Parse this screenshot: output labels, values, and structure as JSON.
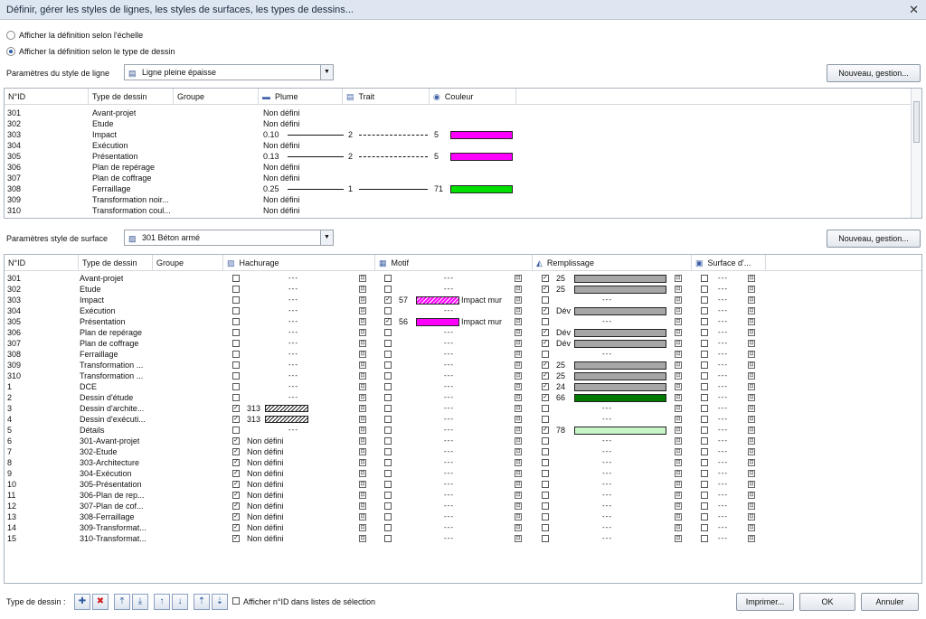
{
  "window": {
    "title": "Définir, gérer les styles de lignes, les styles de surfaces, les types de dessins...",
    "close_icon": "close-icon"
  },
  "options": {
    "radio_scale": "Afficher la définition selon l'échelle",
    "radio_type": "Afficher la définition selon le type de dessin",
    "selected": "radio_type"
  },
  "line_style": {
    "label": "Paramètres du style de ligne",
    "value": "Ligne pleine épaisse",
    "button": "Nouveau, gestion...",
    "columns": [
      "N°ID",
      "Type de dessin",
      "Groupe",
      "Plume",
      "Trait",
      "Couleur"
    ],
    "rows": [
      {
        "id": "301",
        "type": "Avant-projet",
        "plume": "Non défini",
        "trait": "",
        "couleur": "",
        "color": ""
      },
      {
        "id": "302",
        "type": "Etude",
        "plume": "Non défini",
        "trait": "",
        "couleur": "",
        "color": ""
      },
      {
        "id": "303",
        "type": "Impact",
        "plume": "0.10",
        "trait": "2",
        "couleur": "5",
        "color": "#ff00ff",
        "style": "dash"
      },
      {
        "id": "304",
        "type": "Exécution",
        "plume": "Non défini",
        "trait": "",
        "couleur": "",
        "color": ""
      },
      {
        "id": "305",
        "type": "Présentation",
        "plume": "0.13",
        "trait": "2",
        "couleur": "5",
        "color": "#ff00ff",
        "style": "dash"
      },
      {
        "id": "306",
        "type": "Plan de repérage",
        "plume": "Non défini",
        "trait": "",
        "couleur": "",
        "color": ""
      },
      {
        "id": "307",
        "type": "Plan de coffrage",
        "plume": "Non défini",
        "trait": "",
        "couleur": "",
        "color": ""
      },
      {
        "id": "308",
        "type": "Ferraillage",
        "plume": "0.25",
        "trait": "1",
        "couleur": "71",
        "color": "#00e000",
        "style": "solid"
      },
      {
        "id": "309",
        "type": "Transformation noir...",
        "plume": "Non défini",
        "trait": "",
        "couleur": "",
        "color": ""
      },
      {
        "id": "310",
        "type": "Transformation coul...",
        "plume": "Non défini",
        "trait": "",
        "couleur": "",
        "color": ""
      }
    ]
  },
  "surface_style": {
    "label": "Paramètres style de surface",
    "value": "301 Béton armé",
    "button": "Nouveau, gestion...",
    "columns": [
      "N°ID",
      "Type de dessin",
      "Groupe",
      "Hachurage",
      "Motif",
      "Remplissage",
      "Surface d'..."
    ],
    "dashes": "---",
    "rows": [
      {
        "id": "301",
        "type": "Avant-projet",
        "h_chk": false,
        "h_val": "",
        "m_chk": false,
        "m_val": "",
        "m_txt": "",
        "r_chk": true,
        "r_val": "25",
        "r_color": "#a6a6a6"
      },
      {
        "id": "302",
        "type": "Etude",
        "h_chk": false,
        "h_val": "",
        "m_chk": false,
        "m_val": "",
        "m_txt": "",
        "r_chk": true,
        "r_val": "25",
        "r_color": "#a6a6a6"
      },
      {
        "id": "303",
        "type": "Impact",
        "h_chk": false,
        "h_val": "",
        "m_chk": true,
        "m_val": "57",
        "m_txt": "Impact mur",
        "m_color": "pattern",
        "r_chk": false,
        "r_val": "",
        "r_color": ""
      },
      {
        "id": "304",
        "type": "Exécution",
        "h_chk": false,
        "h_val": "",
        "m_chk": false,
        "m_val": "",
        "m_txt": "",
        "r_chk": true,
        "r_val": "Dév",
        "r_color": "#a6a6a6"
      },
      {
        "id": "305",
        "type": "Présentation",
        "h_chk": false,
        "h_val": "",
        "m_chk": true,
        "m_val": "56",
        "m_txt": "Impact mur",
        "m_color": "#ff00ff",
        "r_chk": false,
        "r_val": "",
        "r_color": ""
      },
      {
        "id": "306",
        "type": "Plan de repérage",
        "h_chk": false,
        "h_val": "",
        "m_chk": false,
        "m_val": "",
        "m_txt": "",
        "r_chk": true,
        "r_val": "Dév",
        "r_color": "#a6a6a6"
      },
      {
        "id": "307",
        "type": "Plan de coffrage",
        "h_chk": false,
        "h_val": "",
        "m_chk": false,
        "m_val": "",
        "m_txt": "",
        "r_chk": true,
        "r_val": "Dév",
        "r_color": "#a6a6a6"
      },
      {
        "id": "308",
        "type": "Ferraillage",
        "h_chk": false,
        "h_val": "",
        "m_chk": false,
        "m_val": "",
        "m_txt": "",
        "r_chk": false,
        "r_val": "",
        "r_color": ""
      },
      {
        "id": "309",
        "type": "Transformation ...",
        "h_chk": false,
        "h_val": "",
        "m_chk": false,
        "m_val": "",
        "m_txt": "",
        "r_chk": true,
        "r_val": "25",
        "r_color": "#a6a6a6"
      },
      {
        "id": "310",
        "type": "Transformation ...",
        "h_chk": false,
        "h_val": "",
        "m_chk": false,
        "m_val": "",
        "m_txt": "",
        "r_chk": true,
        "r_val": "25",
        "r_color": "#a6a6a6"
      },
      {
        "id": "1",
        "type": "DCE",
        "h_chk": false,
        "h_val": "",
        "m_chk": false,
        "m_val": "",
        "m_txt": "",
        "r_chk": true,
        "r_val": "24",
        "r_color": "#a6a6a6"
      },
      {
        "id": "2",
        "type": "Dessin d'étude",
        "h_chk": false,
        "h_val": "",
        "m_chk": false,
        "m_val": "",
        "m_txt": "",
        "r_chk": true,
        "r_val": "66",
        "r_color": "#007a00"
      },
      {
        "id": "3",
        "type": "Dessin d'archite...",
        "h_chk": true,
        "h_val": "313",
        "h_hatch": true,
        "m_chk": false,
        "m_val": "",
        "m_txt": "",
        "r_chk": false,
        "r_val": "",
        "r_color": ""
      },
      {
        "id": "4",
        "type": "Dessin d'exécuti...",
        "h_chk": true,
        "h_val": "313",
        "h_hatch": true,
        "m_chk": false,
        "m_val": "",
        "m_txt": "",
        "r_chk": false,
        "r_val": "",
        "r_color": ""
      },
      {
        "id": "5",
        "type": "Détails",
        "h_chk": false,
        "h_val": "",
        "m_chk": false,
        "m_val": "",
        "m_txt": "",
        "r_chk": true,
        "r_val": "78",
        "r_color": "#c8f5c8"
      },
      {
        "id": "6",
        "type": "301-Avant-projet",
        "h_chk": true,
        "h_val": "Non défini",
        "m_chk": false,
        "m_val": "",
        "m_txt": "",
        "r_chk": false,
        "r_val": "",
        "r_color": ""
      },
      {
        "id": "7",
        "type": "302-Etude",
        "h_chk": true,
        "h_val": "Non défini",
        "m_chk": false,
        "m_val": "",
        "m_txt": "",
        "r_chk": false,
        "r_val": "",
        "r_color": ""
      },
      {
        "id": "8",
        "type": "303-Architecture",
        "h_chk": true,
        "h_val": "Non défini",
        "m_chk": false,
        "m_val": "",
        "m_txt": "",
        "r_chk": false,
        "r_val": "",
        "r_color": ""
      },
      {
        "id": "9",
        "type": "304-Exécution",
        "h_chk": true,
        "h_val": "Non défini",
        "m_chk": false,
        "m_val": "",
        "m_txt": "",
        "r_chk": false,
        "r_val": "",
        "r_color": ""
      },
      {
        "id": "10",
        "type": "305-Présentation",
        "h_chk": true,
        "h_val": "Non défini",
        "m_chk": false,
        "m_val": "",
        "m_txt": "",
        "r_chk": false,
        "r_val": "",
        "r_color": ""
      },
      {
        "id": "11",
        "type": "306-Plan de rep...",
        "h_chk": true,
        "h_val": "Non défini",
        "m_chk": false,
        "m_val": "",
        "m_txt": "",
        "r_chk": false,
        "r_val": "",
        "r_color": ""
      },
      {
        "id": "12",
        "type": "307-Plan de cof...",
        "h_chk": true,
        "h_val": "Non défini",
        "m_chk": false,
        "m_val": "",
        "m_txt": "",
        "r_chk": false,
        "r_val": "",
        "r_color": ""
      },
      {
        "id": "13",
        "type": "308-Ferraillage",
        "h_chk": true,
        "h_val": "Non défini",
        "m_chk": false,
        "m_val": "",
        "m_txt": "",
        "r_chk": false,
        "r_val": "",
        "r_color": ""
      },
      {
        "id": "14",
        "type": "309-Transformat...",
        "h_chk": true,
        "h_val": "Non défini",
        "m_chk": false,
        "m_val": "",
        "m_txt": "",
        "r_chk": false,
        "r_val": "",
        "r_color": ""
      },
      {
        "id": "15",
        "type": "310-Transformat...",
        "h_chk": true,
        "h_val": "Non défini",
        "m_chk": false,
        "m_val": "",
        "m_txt": "",
        "r_chk": false,
        "r_val": "",
        "r_color": ""
      }
    ]
  },
  "footer": {
    "type_label": "Type de dessin :",
    "show_id_label": "Afficher n°ID dans listes de sélection",
    "print": "Imprimer...",
    "ok": "OK",
    "cancel": "Annuler",
    "tools": [
      "add-icon",
      "delete-icon",
      "move-top-icon",
      "move-bottom-icon",
      "move-up-icon",
      "move-down-icon",
      "import-icon",
      "export-icon"
    ]
  }
}
